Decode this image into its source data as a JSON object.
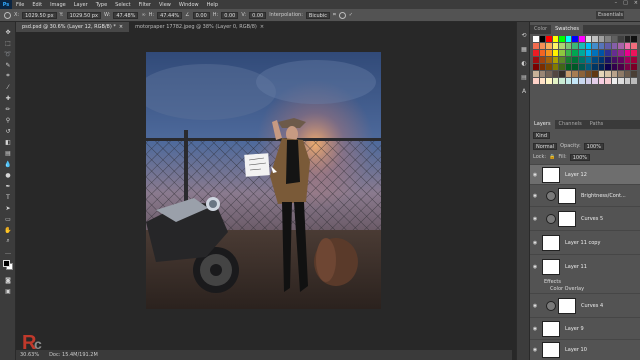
{
  "app": {
    "logo": "Ps",
    "menu": [
      "File",
      "Edit",
      "Image",
      "Layer",
      "Type",
      "Select",
      "Filter",
      "View",
      "Window",
      "Help"
    ],
    "window_controls": [
      "–",
      "□",
      "×"
    ]
  },
  "options_bar": {
    "x": "1029.50 px",
    "y": "1029.50 px",
    "w": "47.48%",
    "h": "47.44%",
    "angle": "0.00",
    "h_skew": "0.00",
    "v_skew": "0.00",
    "interpolation_label": "Interpolation:",
    "interpolation": "Bicubic",
    "workspace": "Essentials"
  },
  "tabs": [
    {
      "label": "psd.psd @ 30.6% (Layer 12, RGB/8) *",
      "active": true
    },
    {
      "label": "motorpaper 17782.jpeg @ 38% (Layer 0, RGB/8)",
      "active": false
    }
  ],
  "status": {
    "zoom": "30.63%",
    "doc": "Doc: 15.4M/191.2M"
  },
  "swatches_panel": {
    "tabs": [
      "Color",
      "Swatches"
    ],
    "active_tab": "Swatches",
    "colors": [
      "#ffffff",
      "#000000",
      "#ff0000",
      "#ffff00",
      "#00ff00",
      "#00ffff",
      "#0000ff",
      "#ff00ff",
      "#e0e0e0",
      "#c0c0c0",
      "#a0a0a0",
      "#808080",
      "#606060",
      "#404040",
      "#202020",
      "#101010",
      "#f26c4f",
      "#f68e55",
      "#fbaf5c",
      "#fff467",
      "#acd372",
      "#7cc576",
      "#3bb878",
      "#1abbb4",
      "#00bff3",
      "#438ccb",
      "#5574b9",
      "#605ca8",
      "#855fa8",
      "#a763a9",
      "#f06eaa",
      "#f26d7d",
      "#ed1c24",
      "#f26522",
      "#f7941d",
      "#fff200",
      "#8dc63f",
      "#39b54a",
      "#00a651",
      "#00a99d",
      "#00aeef",
      "#0072bc",
      "#0054a6",
      "#2e3192",
      "#662d91",
      "#92278f",
      "#ec008c",
      "#ed145b",
      "#9e0b0f",
      "#a0410d",
      "#a3620a",
      "#aba000",
      "#598527",
      "#197b30",
      "#007236",
      "#00746b",
      "#0076a3",
      "#004a80",
      "#003471",
      "#1b1464",
      "#440e62",
      "#630460",
      "#9e005d",
      "#9e0039",
      "#790000",
      "#7b2e00",
      "#7d4900",
      "#827b00",
      "#406618",
      "#005e20",
      "#005826",
      "#005952",
      "#005b7f",
      "#003663",
      "#002157",
      "#0d004c",
      "#32004b",
      "#4b0049",
      "#7b0046",
      "#7a0026",
      "#c7b299",
      "#998675",
      "#736357",
      "#534741",
      "#37302a",
      "#c69c6d",
      "#a67c52",
      "#8c6239",
      "#754c24",
      "#603813",
      "#e6d5b8",
      "#d8c3a5",
      "#b8a28a",
      "#8e7a66",
      "#6b5b4c",
      "#4a3f35",
      "#ffd3c9",
      "#ffe2c7",
      "#fff7c4",
      "#e2f2c4",
      "#c9ebd4",
      "#c4ebea",
      "#c4e6f7",
      "#c9d7ee",
      "#d3cde8",
      "#e3cde8",
      "#f7cde1",
      "#f7cdd2",
      "#eeeeee",
      "#dddddd",
      "#cccccc",
      "#bbbbbb"
    ]
  },
  "layers_panel": {
    "tabs": [
      "Layers",
      "Channels",
      "Paths"
    ],
    "active_tab": "Layers",
    "kind": "Kind",
    "blend_mode": "Normal",
    "opacity_label": "Opacity:",
    "opacity": "100%",
    "lock_label": "Lock:",
    "fill_label": "Fill:",
    "fill": "100%",
    "layers": [
      {
        "name": "Layer 12",
        "type": "pixel",
        "selected": true
      },
      {
        "name": "Brightness/Cont...",
        "type": "adjustment",
        "selected": false
      },
      {
        "name": "Curves 5",
        "type": "adjustment",
        "selected": false
      },
      {
        "name": "Layer 11 copy",
        "type": "pixel",
        "selected": false
      },
      {
        "name": "Layer 11",
        "type": "pixel",
        "selected": false
      },
      {
        "name": "Curves 4",
        "type": "adjustment",
        "selected": false
      },
      {
        "name": "Layer 9",
        "type": "pixel",
        "selected": false
      },
      {
        "name": "Layer 10",
        "type": "pixel",
        "selected": false
      }
    ],
    "effects": [
      "Effects",
      "Color Overlay"
    ]
  }
}
